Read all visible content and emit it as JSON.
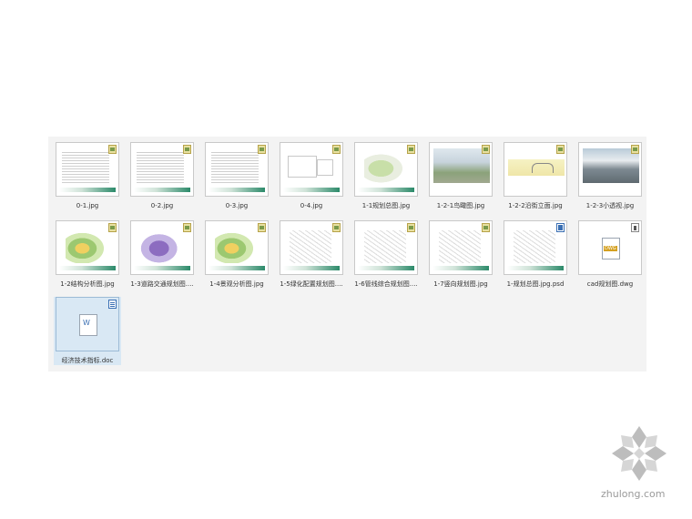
{
  "files": [
    {
      "name": "0-1.jpg",
      "kind": "doc-page",
      "badge": "image"
    },
    {
      "name": "0-2.jpg",
      "kind": "doc-page",
      "badge": "image"
    },
    {
      "name": "0-3.jpg",
      "kind": "doc-page",
      "badge": "image"
    },
    {
      "name": "0-4.jpg",
      "kind": "sketch",
      "badge": "image"
    },
    {
      "name": "1-1规划总图.jpg",
      "kind": "plan",
      "badge": "image"
    },
    {
      "name": "1-2-1鸟瞰图.jpg",
      "kind": "aerial",
      "badge": "image"
    },
    {
      "name": "1-2-2沿街立面.jpg",
      "kind": "elevation",
      "badge": "image"
    },
    {
      "name": "1-2-3小透视.jpg",
      "kind": "perspective",
      "badge": "image"
    },
    {
      "name": "1-2结构分析图.jpg",
      "kind": "plan-color",
      "badge": "image"
    },
    {
      "name": "1-3道路交通规划图....",
      "kind": "plan-purple",
      "badge": "image"
    },
    {
      "name": "1-4景观分析图.jpg",
      "kind": "plan-color",
      "badge": "image"
    },
    {
      "name": "1-5绿化配置规划图....",
      "kind": "plan-lines",
      "badge": "image"
    },
    {
      "name": "1-6管线综合规划图....",
      "kind": "plan-lines",
      "badge": "image"
    },
    {
      "name": "1-7竖向规划图.jpg",
      "kind": "plan-lines",
      "badge": "image"
    },
    {
      "name": "1-规划总图.jpg.psd",
      "kind": "plan-lines",
      "badge": "psd"
    },
    {
      "name": "cad规划图.dwg",
      "kind": "dwg",
      "badge": "cad"
    },
    {
      "name": "经济技术指标.doc",
      "kind": "doc",
      "badge": "doc",
      "selected": true
    }
  ],
  "watermark": {
    "text": "zhulong.com"
  }
}
